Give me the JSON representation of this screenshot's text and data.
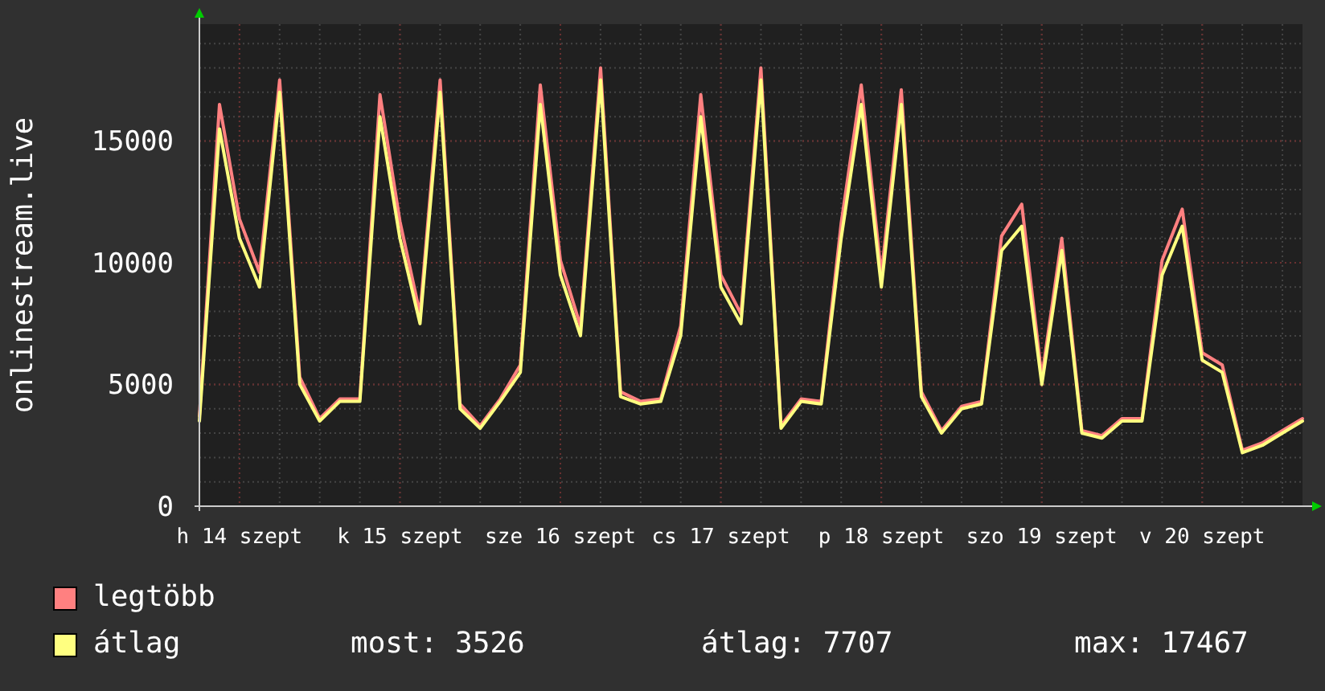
{
  "chart_data": {
    "type": "line",
    "ylabel": "onlinestream.live",
    "categories": [
      null,
      null,
      "h 14 szept",
      null,
      null,
      null,
      null,
      null,
      null,
      null,
      "k 15 szept",
      null,
      null,
      null,
      null,
      null,
      null,
      null,
      "sze 16 szept",
      null,
      null,
      null,
      null,
      null,
      null,
      null,
      "cs 17 szept",
      null,
      null,
      null,
      null,
      null,
      null,
      null,
      "p 18 szept",
      null,
      null,
      null,
      null,
      null,
      null,
      null,
      "szo 19 szept",
      null,
      null,
      null,
      null,
      null,
      null,
      null,
      "v 20 szept",
      null,
      null,
      null,
      null,
      null
    ],
    "series": [
      {
        "name": "legtöbb",
        "color": "#ff8080",
        "values": [
          3700,
          16500,
          11800,
          9600,
          17500,
          5300,
          3600,
          4400,
          4400,
          16900,
          11700,
          7900,
          17500,
          4200,
          3300,
          4400,
          5800,
          17300,
          10100,
          7400,
          18000,
          4700,
          4300,
          4400,
          7400,
          16900,
          9500,
          7900,
          18000,
          3300,
          4400,
          4300,
          11600,
          17300,
          9500,
          17100,
          4700,
          3100,
          4100,
          4300,
          11100,
          12400,
          5300,
          11000,
          3100,
          2900,
          3600,
          3600,
          10100,
          12200,
          6300,
          5800,
          2300,
          2600,
          3100,
          3600
        ]
      },
      {
        "name": "átlag",
        "color": "#ffff80",
        "values": [
          3500,
          15500,
          11000,
          9000,
          17000,
          5000,
          3500,
          4300,
          4300,
          16000,
          11000,
          7500,
          17000,
          4000,
          3200,
          4300,
          5500,
          16500,
          9500,
          7000,
          17500,
          4500,
          4200,
          4300,
          7000,
          16000,
          9000,
          7500,
          17500,
          3200,
          4300,
          4200,
          11000,
          16500,
          9000,
          16500,
          4500,
          3000,
          4000,
          4200,
          10500,
          11500,
          5000,
          10500,
          3000,
          2800,
          3500,
          3500,
          9500,
          11500,
          6000,
          5500,
          2200,
          2500,
          3000,
          3500
        ]
      }
    ],
    "grid": true,
    "ylim": [
      0,
      19800
    ],
    "yticks": [
      0,
      5000,
      10000,
      15000
    ]
  },
  "stats": [
    "most: 3526",
    "átlag: 7707",
    "max: 17467"
  ]
}
